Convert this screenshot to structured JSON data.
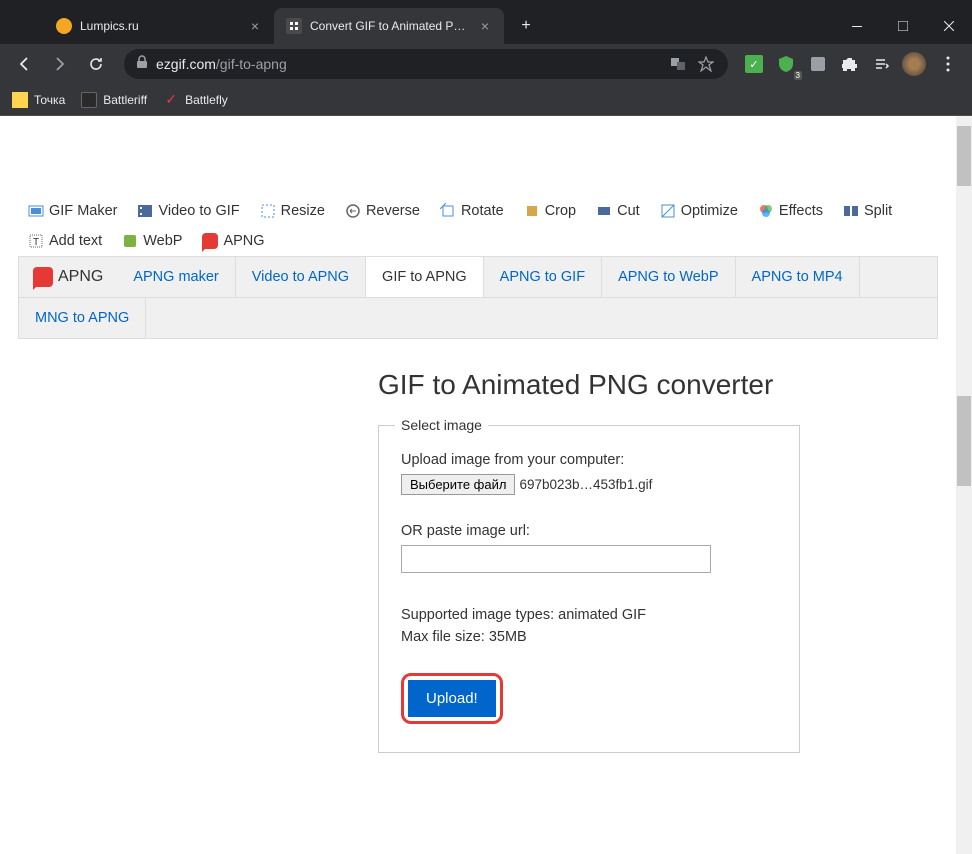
{
  "tabs": {
    "inactive": "Lumpics.ru",
    "active": "Convert GIF to Animated PNG"
  },
  "url": {
    "host": "ezgif.com",
    "path": "/gif-to-apng"
  },
  "bookmarks": {
    "b1": "Точка",
    "b2": "Battleriff",
    "b3": "Battlefly"
  },
  "toolnav": {
    "gifmaker": "GIF Maker",
    "video": "Video to GIF",
    "resize": "Resize",
    "reverse": "Reverse",
    "rotate": "Rotate",
    "crop": "Crop",
    "cut": "Cut",
    "optimize": "Optimize",
    "effects": "Effects",
    "split": "Split",
    "addtext": "Add text",
    "webp": "WebP",
    "apng": "APNG"
  },
  "subnav": {
    "logo": "APNG",
    "maker": "APNG maker",
    "video": "Video to APNG",
    "gif": "GIF to APNG",
    "togif": "APNG to GIF",
    "towebp": "APNG to WebP",
    "tomp4": "APNG to MP4",
    "mng": "MNG to APNG"
  },
  "page": {
    "title": "GIF to Animated PNG converter",
    "legend": "Select image",
    "upload_label": "Upload image from your computer:",
    "file_btn": "Выберите файл",
    "file_name": "697b023b…453fb1.gif",
    "or_label": "OR paste image url:",
    "supported": "Supported image types: animated GIF",
    "maxsize": "Max file size: 35MB",
    "upload_btn": "Upload!"
  },
  "ext_badge": "3"
}
